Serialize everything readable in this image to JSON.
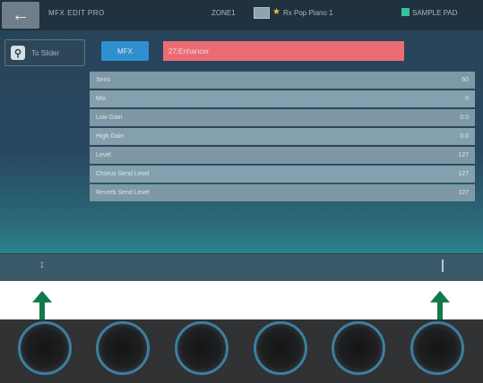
{
  "topbar": {
    "back_icon": "back-arrow-icon",
    "title": "MFX EDIT PRO",
    "zone": "ZONE1",
    "preset": "Rx Pop Piano 1",
    "sample_pad": "SAMPLE PAD"
  },
  "sidebar": {
    "to_slider_label": "To Slider"
  },
  "header": {
    "mfx_button": "MFX",
    "type_value": "27:Enhancer"
  },
  "params": [
    {
      "label": "Sens",
      "value": "60"
    },
    {
      "label": "Mix",
      "value": "0"
    },
    {
      "label": "Low Gain",
      "value": "0.0"
    },
    {
      "label": "High Gain",
      "value": "0.0"
    },
    {
      "label": "Level",
      "value": "127"
    },
    {
      "label": "Chorus Send Level",
      "value": "127"
    },
    {
      "label": "Reverb Send Level",
      "value": "127"
    }
  ],
  "colors": {
    "accent_blue": "#2f8fd0",
    "type_red": "#ec6c73",
    "arrow_green": "#127a4a",
    "knob_ring": "#3b7fa0"
  }
}
